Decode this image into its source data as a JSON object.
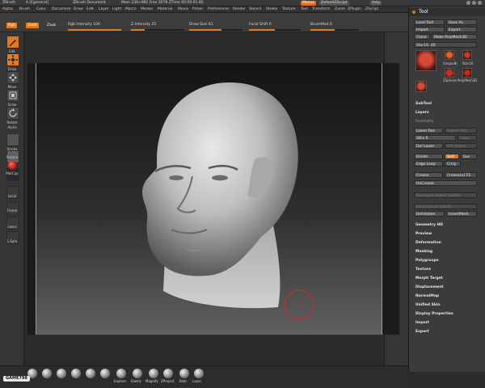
{
  "titlebar": {
    "app": "ZBrush",
    "version": "4.2[general]",
    "document": "ZBrush Document",
    "stats": "Mem 236+981  Free 2078  ZTime 00:00:01.85",
    "menus_label": "Menus",
    "script_label": "DefaultZScript",
    "help_label": "Help"
  },
  "menubar": {
    "items": [
      "Alpha",
      "Brush",
      "Color",
      "Document",
      "Draw",
      "Edit",
      "Layer",
      "Light",
      "Macro",
      "Marker",
      "Material",
      "Movie",
      "Picker",
      "Preferences",
      "Render",
      "Stencil",
      "Stroke",
      "Texture",
      "Tool",
      "Transform",
      "Zoom",
      "ZPlugin",
      "ZScript"
    ]
  },
  "topbar": {
    "rgb": "Rgb",
    "zadd": "Zadd",
    "zsub": "Zsub",
    "rgb_intensity": "Rgb Intensity 100",
    "z_intensity": "Z Intensity 25",
    "draw_size": "Draw Size 61",
    "focal_shift": "Focal Shift 0",
    "brush_mod": "BrushMod 0",
    "rgb_intensity_value": 1.0,
    "z_intensity_value": 0.25,
    "draw_size_value": 0.6,
    "focal_shift_value": 0.5,
    "brush_mod_value": 0.5
  },
  "leftshelf": {
    "items": [
      {
        "label": "Edit",
        "icon": "edit-pencil-icon",
        "active": true
      },
      {
        "label": "Draw",
        "icon": "draw-icon",
        "active": true
      },
      {
        "label": "Move",
        "icon": "move-icon",
        "active": false
      },
      {
        "label": "Scale",
        "icon": "scale-icon",
        "active": false
      },
      {
        "label": "Rotate",
        "icon": "rotate-icon",
        "active": false
      }
    ],
    "labels": [
      "Alpha",
      "Stroke",
      "Texture",
      "MatCap",
      "Local",
      "Frame",
      "Lasso",
      "L.Sym"
    ]
  },
  "toolpanel": {
    "title": "Tool",
    "load_tool": "Load Tool",
    "save_as": "Save As",
    "import": "Import",
    "export": "Export",
    "clone": "Clone",
    "make_polymesh": "Make PolyMesh3D",
    "current_tool": "Star16. 48",
    "thumb_captions": [
      "SimpleBr",
      "Star16",
      "ZSphere",
      "PolyMesh3D"
    ],
    "sections_top": [
      "SubTool",
      "Layers",
      "Geometry"
    ],
    "lower_res": "Lower Res",
    "higher_res": "Higher Res",
    "sdiv": "SDiv 6",
    "cage": "Cage",
    "del_lower": "Del Lower",
    "del_higher": "Del Higher",
    "divide": "Divide",
    "smt": "Smt",
    "suv": "Suv",
    "edge_loop": "Edge Loop",
    "crisp": "Crisp",
    "crease": "Crease",
    "crease_lvl": "CreaseLvl 15",
    "uncrease": "UnCrease",
    "reproject": "Reproject Higher Subdiv",
    "reconstruct": "Reconstruct Subdiv",
    "del_hidden": "DelHidden",
    "insert_mesh": "InsertMesh",
    "sections_bottom": [
      "Geometry HD",
      "Preview",
      "Deformation",
      "Masking",
      "Polygroups",
      "Texture",
      "Morph Target",
      "Displacement",
      "NormalMap",
      "Unified Skin",
      "Display Properties",
      "Import",
      "Export"
    ]
  },
  "bottombar": {
    "badge": "GAME798",
    "labels": [
      "Explore",
      "Elastic",
      "Magnify",
      "ZProject",
      "Blob",
      "Layer"
    ]
  },
  "colors": {
    "accent": "#e07a1c",
    "panel": "#3b3b3b",
    "canvas_top": "#141414",
    "canvas_bottom": "#606060"
  }
}
